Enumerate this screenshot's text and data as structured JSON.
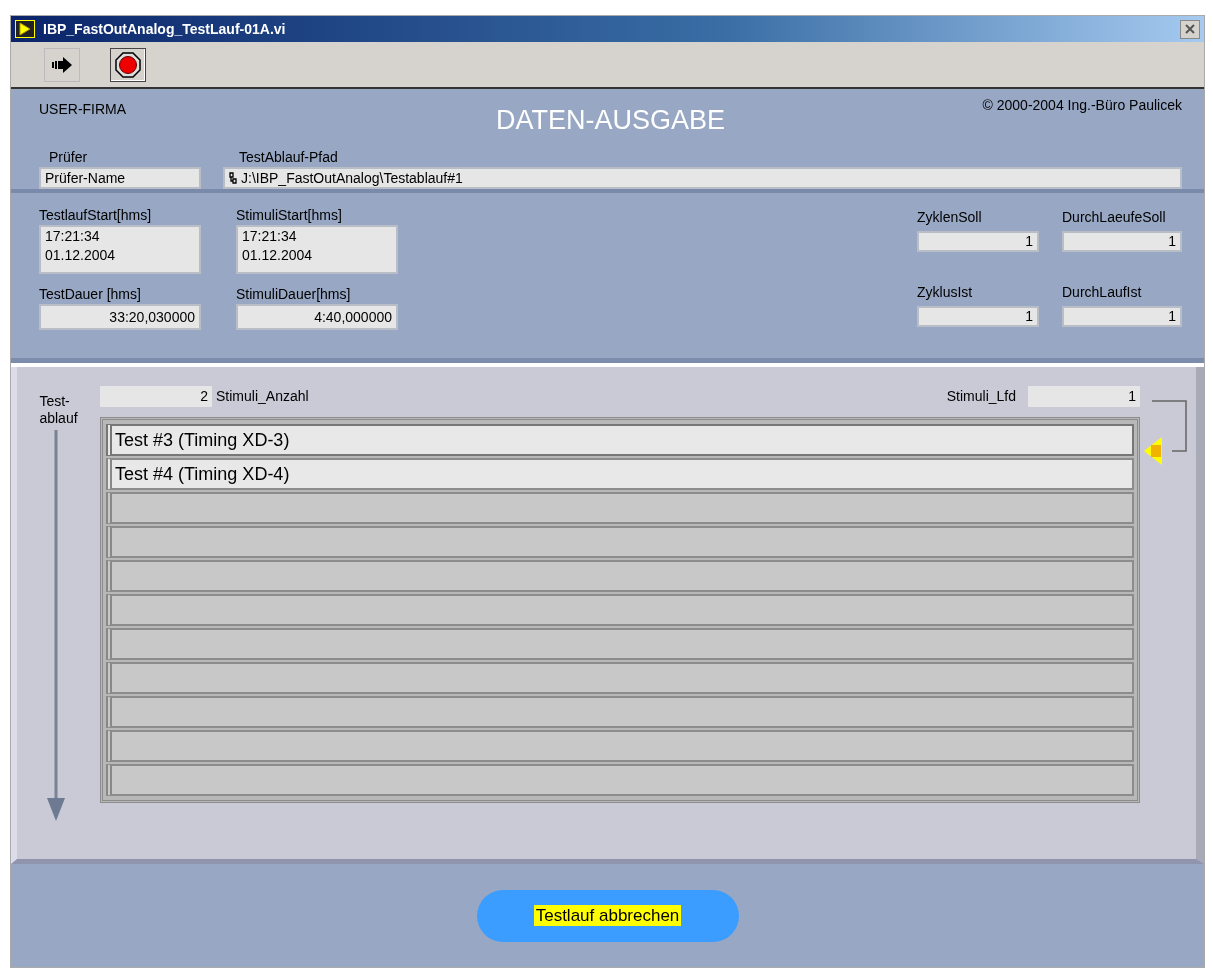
{
  "window": {
    "title": "IBP_FastOutAnalog_TestLauf-01A.vi"
  },
  "header": {
    "company": "USER-FIRMA",
    "heading": "DATEN-AUSGABE",
    "copyright": "© 2000-2004 Ing.-Büro Paulicek",
    "fields": [
      {
        "label": "Prüfer",
        "value": "Prüfer-Name"
      },
      {
        "label": "TestAblauf-Pfad",
        "value": "J:\\IBP_FastOutAnalog\\Testablauf#1"
      }
    ]
  },
  "timing": {
    "fields": [
      {
        "label": "TestlaufStart[hms]",
        "value": "17:21:34\n01.12.2004"
      },
      {
        "label": "StimuliStart[hms]",
        "value": "17:21:34\n01.12.2004"
      },
      {
        "label": "TestDauer [hms]",
        "value": "33:20,030000"
      },
      {
        "label": "StimuliDauer[hms]",
        "value": "4:40,000000"
      }
    ],
    "counters": [
      {
        "label": "ZyklenSoll",
        "value": "1"
      },
      {
        "label": "DurchLaeufeSoll",
        "value": "1"
      },
      {
        "label": "ZyklusIst",
        "value": "1"
      },
      {
        "label": "DurchLaufIst",
        "value": "1"
      }
    ]
  },
  "sequence": {
    "label": "Test-\nablauf",
    "count": {
      "value": "2",
      "label": "Stimuli_Anzahl"
    },
    "current": {
      "label": "Stimuli_Lfd",
      "value": "1"
    },
    "items": [
      {
        "text": "Test #3 (Timing XD-3)",
        "selected": true
      },
      {
        "text": "Test #4 (Timing XD-4)",
        "selected": false
      }
    ]
  },
  "button": {
    "label": "Testlauf abbrechen"
  }
}
